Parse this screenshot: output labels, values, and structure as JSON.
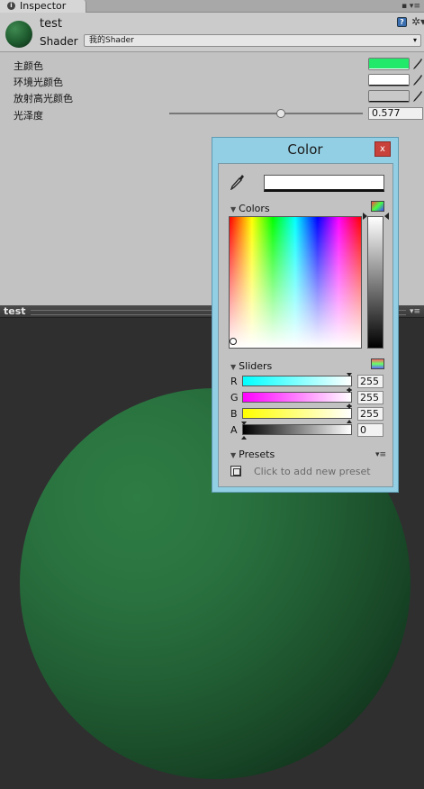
{
  "tab": {
    "label": "Inspector",
    "icon": "info-icon",
    "tools": "▪ ▾≡"
  },
  "material": {
    "name": "test",
    "shader_label": "Shader",
    "shader_value": "我的Shader",
    "help_icon": "?",
    "gear_icon": "✲▾"
  },
  "properties": [
    {
      "label": "主颜色",
      "color": "#22e96a"
    },
    {
      "label": "环境光颜色",
      "color": "#ffffff"
    },
    {
      "label": "放射高光颜色",
      "color": "#c8c8c8"
    }
  ],
  "gloss": {
    "label": "光泽度",
    "value": "0.577",
    "fraction": 0.577
  },
  "preview": {
    "title": "test",
    "tools": "▾≡"
  },
  "color_window": {
    "title": "Color",
    "close": "x",
    "current_color": "#ffffff",
    "colors_label": "Colors",
    "sliders_label": "Sliders",
    "sliders": [
      {
        "letter": "R",
        "value": "255",
        "gradient": "linear-gradient(to right, #00ffff, #ffffff)"
      },
      {
        "letter": "G",
        "value": "255",
        "gradient": "linear-gradient(to right, #ff00ff, #ffffff)"
      },
      {
        "letter": "B",
        "value": "255",
        "gradient": "linear-gradient(to right, #ffff00, #ffffff)"
      },
      {
        "letter": "A",
        "value": "0",
        "gradient": "linear-gradient(to right, #000000, #ffffff)"
      }
    ],
    "presets_label": "Presets",
    "preset_hint": "Click to add new preset",
    "menu_icon": "▾≡"
  }
}
